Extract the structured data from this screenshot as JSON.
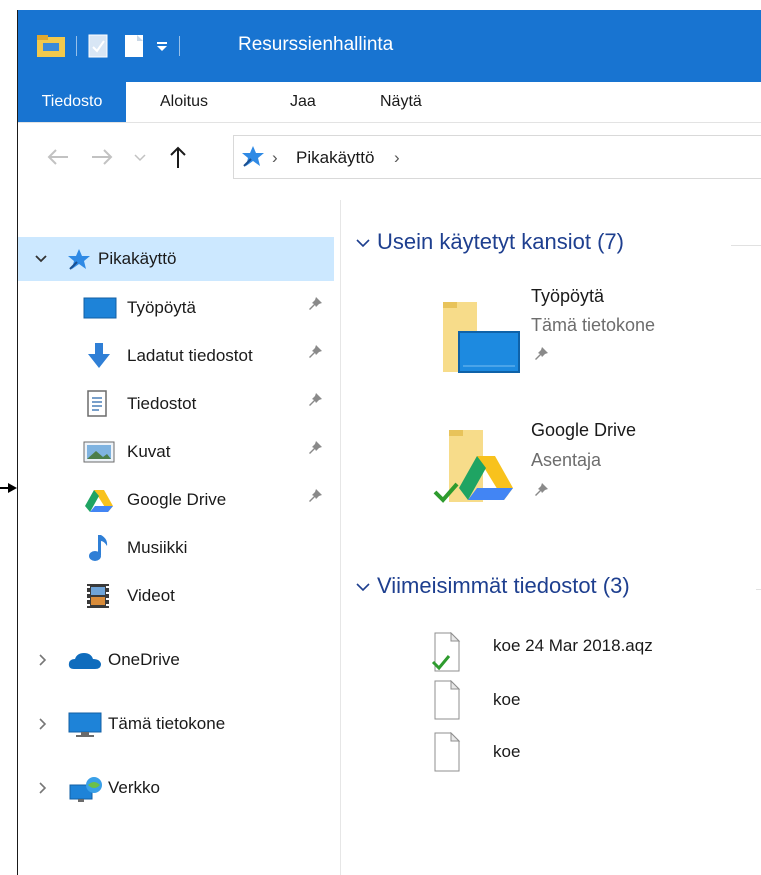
{
  "titlebar": {
    "title": "Resurssienhallinta"
  },
  "ribbon": {
    "tabs": [
      "Tiedosto",
      "Aloitus",
      "Jaa",
      "Näytä"
    ]
  },
  "address": {
    "breadcrumb": "Pikakäyttö",
    "separator": "›"
  },
  "nav": {
    "quick_access": "Pikakäyttö",
    "items": [
      {
        "label": "Työpöytä",
        "icon": "desktop-icon",
        "pinned": true
      },
      {
        "label": "Ladatut tiedostot",
        "icon": "download-icon",
        "pinned": true
      },
      {
        "label": "Tiedostot",
        "icon": "documents-icon",
        "pinned": true
      },
      {
        "label": "Kuvat",
        "icon": "pictures-icon",
        "pinned": true
      },
      {
        "label": "Google Drive",
        "icon": "google-drive-icon",
        "pinned": true
      },
      {
        "label": "Musiikki",
        "icon": "music-icon",
        "pinned": false
      },
      {
        "label": "Videot",
        "icon": "videos-icon",
        "pinned": false
      }
    ],
    "roots": [
      {
        "label": "OneDrive",
        "icon": "onedrive-icon"
      },
      {
        "label": "Tämä tietokone",
        "icon": "this-pc-icon"
      },
      {
        "label": "Verkko",
        "icon": "network-icon"
      }
    ]
  },
  "content": {
    "frequent_header": "Usein käytetyt kansiot (7)",
    "folders": [
      {
        "name": "Työpöytä",
        "location": "Tämä tietokone"
      },
      {
        "name": "Google Drive",
        "location": "Asentaja"
      }
    ],
    "recent_header": "Viimeisimmät tiedostot (3)",
    "files": [
      {
        "name": "koe 24 Mar 2018.aqz",
        "synced": true
      },
      {
        "name": "koe",
        "synced": false
      },
      {
        "name": "koe",
        "synced": false
      }
    ]
  },
  "colors": {
    "accent": "#1874d1",
    "selected_bg": "#cce8ff",
    "header_text": "#1e3f8f"
  }
}
